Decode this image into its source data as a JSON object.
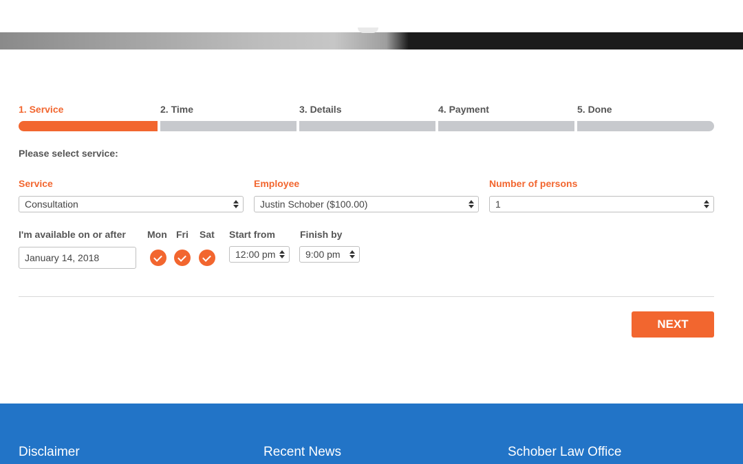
{
  "steps": [
    {
      "label": "1. Service",
      "active": true
    },
    {
      "label": "2. Time",
      "active": false
    },
    {
      "label": "3. Details",
      "active": false
    },
    {
      "label": "4. Payment",
      "active": false
    },
    {
      "label": "5. Done",
      "active": false
    }
  ],
  "prompt": "Please select service:",
  "fields": {
    "service": {
      "label": "Service",
      "value": "Consultation"
    },
    "employee": {
      "label": "Employee",
      "value": "Justin Schober ($100.00)"
    },
    "persons": {
      "label": "Number of persons",
      "value": "1"
    }
  },
  "availability": {
    "label": "I'm available on or after",
    "date": "January 14, 2018",
    "days": [
      {
        "label": "Mon",
        "checked": true
      },
      {
        "label": "Fri",
        "checked": true
      },
      {
        "label": "Sat",
        "checked": true
      }
    ],
    "start_label": "Start from",
    "start_value": "12:00 pm",
    "finish_label": "Finish by",
    "finish_value": "9:00 pm"
  },
  "next_label": "NEXT",
  "footer": {
    "col1": "Disclaimer",
    "col2": "Recent News",
    "col3": "Schober Law Office"
  },
  "colors": {
    "accent": "#f2662f",
    "footer_bg": "#2274c7",
    "bar_inactive": "#c7c9cd"
  }
}
